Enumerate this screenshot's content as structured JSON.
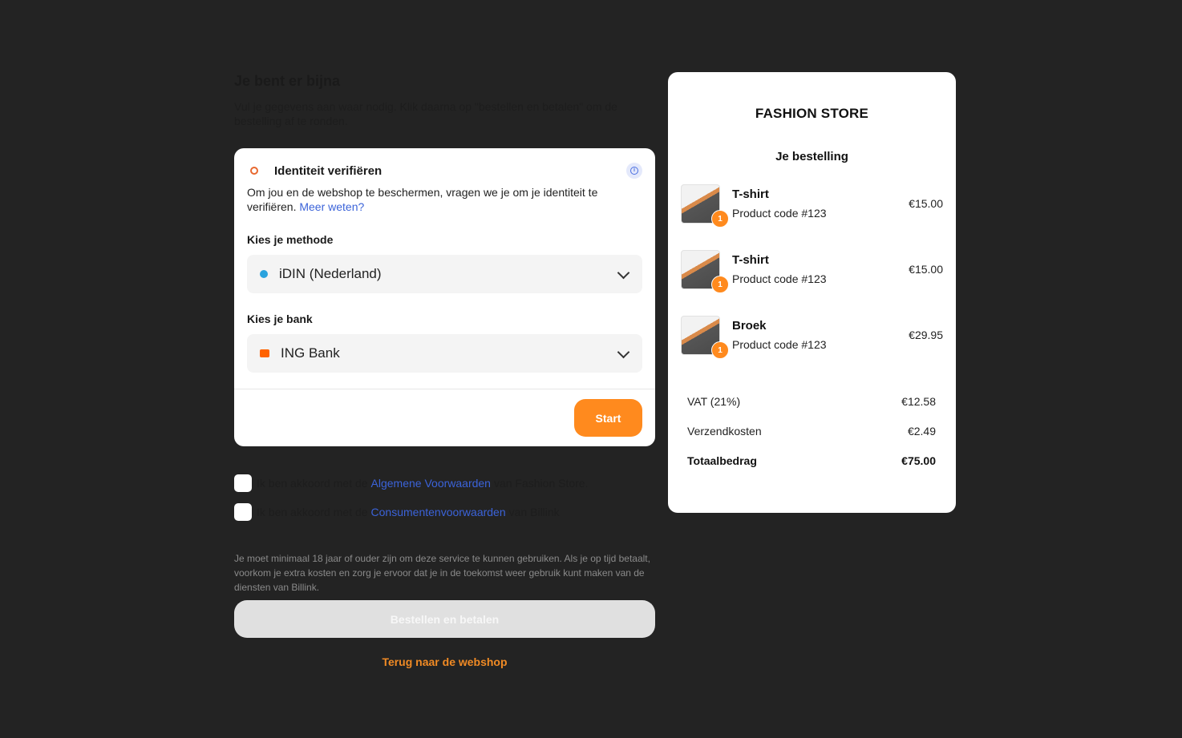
{
  "left": {
    "title": "Je bent er bijna",
    "subtitle": "Vul je gegevens aan waar nodig. Klik daarna op \"bestellen en betalen\" om de bestelling af te ronden."
  },
  "verify": {
    "title": "Identiteit verifiëren",
    "description": "Om jou en de webshop te beschermen, vragen we je om je identiteit te verifiëren.",
    "more_link": "Meer weten?",
    "method_label": "Kies je methode",
    "method_value": "iDIN (Nederland)",
    "bank_label": "Kies je bank",
    "bank_value": "ING Bank",
    "start_label": "Start"
  },
  "terms": {
    "row1_prefix": "Ik ben akkoord met de",
    "row1_link": "Algemene Voorwaarden",
    "row1_suffix": "van Fashion Store.",
    "row2_prefix": "Ik ben akkoord met de",
    "row2_link": "Consumentenvoorwaarden",
    "row2_suffix": "van Billink"
  },
  "fine_print": "Je moet minimaal 18 jaar of ouder zijn om deze service te kunnen gebruiken. Als je op tijd betaalt, voorkom je extra kosten en zorg je ervoor dat je in de toekomst weer gebruik kunt maken van de diensten van Billink.",
  "order_button": "Bestellen en betalen",
  "back_link": "Terug naar de webshop",
  "summary": {
    "store": "FASHION STORE",
    "heading": "Je bestelling",
    "items": [
      {
        "name": "T-shirt",
        "code": "Product code #123",
        "price": "€15.00",
        "qty": "1"
      },
      {
        "name": "T-shirt",
        "code": "Product code #123",
        "price": "€15.00",
        "qty": "1"
      },
      {
        "name": "Broek",
        "code": "Product code #123",
        "price": "€29.95",
        "qty": "1"
      }
    ],
    "vat_label": "VAT (21%)",
    "vat_value": "€12.58",
    "shipping_label": "Verzendkosten",
    "shipping_value": "€2.49",
    "total_label": "Totaalbedrag",
    "total_value": "€75.00"
  },
  "colors": {
    "accent": "#ff8a1e",
    "link": "#3b63d9",
    "background": "#232323"
  }
}
